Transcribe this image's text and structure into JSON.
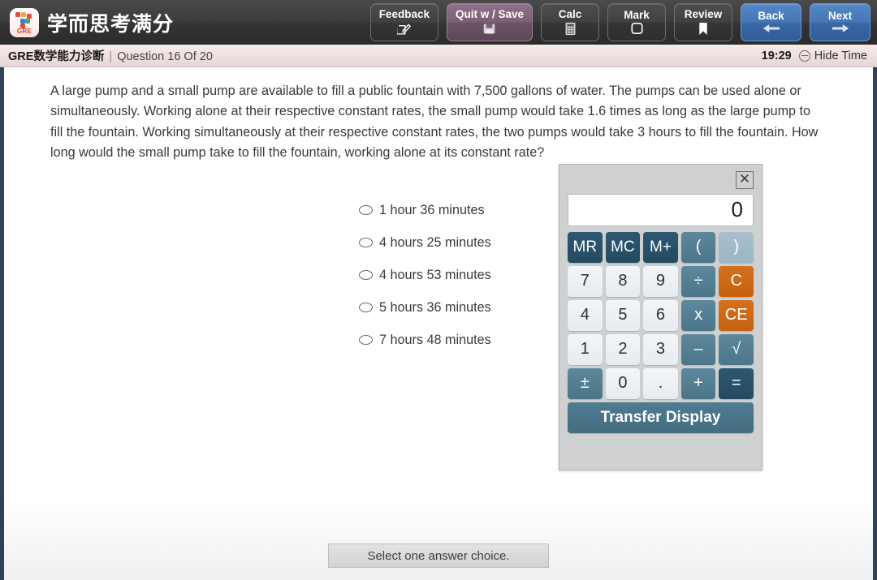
{
  "header": {
    "brand_title": "学而思考满分",
    "logo_badge": "GRE",
    "buttons": [
      {
        "label": "Feedback",
        "icon": "edit-square-icon",
        "style": "default"
      },
      {
        "label": "Quit w / Save",
        "icon": "save-disk-icon",
        "style": "quit"
      },
      {
        "label": "Calc",
        "icon": "calculator-icon",
        "style": "default"
      },
      {
        "label": "Mark",
        "icon": "square-outline-icon",
        "style": "default"
      },
      {
        "label": "Review",
        "icon": "bookmark-icon",
        "style": "default"
      },
      {
        "label": "Back",
        "icon": "arrow-left-icon",
        "style": "nav"
      },
      {
        "label": "Next",
        "icon": "arrow-right-icon",
        "style": "nav"
      }
    ]
  },
  "subheader": {
    "section_name": "GRE数学能力诊断",
    "separator": "|",
    "question_count": "Question 16 Of 20",
    "timer": "19:29",
    "hide_time_label": "Hide Time",
    "hide_time_icon": "minus-circle-icon"
  },
  "question": {
    "stem": "A large pump and a small pump are available to fill a public fountain with 7,500 gallons of water. The pumps can be used alone or simultaneously. Working alone at their respective constant rates, the small pump would take 1.6 times as long as the large pump to fill the fountain. Working simultaneously at their respective constant rates, the two pumps would take 3 hours to fill the fountain. How long would the small pump take to fill the fountain, working alone at its constant rate?",
    "choices": [
      {
        "label": "1 hour 36 minutes",
        "selected": false
      },
      {
        "label": "4 hours 25 minutes",
        "selected": false
      },
      {
        "label": "4 hours 53 minutes",
        "selected": false
      },
      {
        "label": "5 hours 36 minutes",
        "selected": false
      },
      {
        "label": "7 hours 48 minutes",
        "selected": false
      }
    ]
  },
  "calculator": {
    "close_icon": "close-x-icon",
    "display_value": "0",
    "keys": [
      {
        "label": "MR",
        "kind": "mem"
      },
      {
        "label": "MC",
        "kind": "mem"
      },
      {
        "label": "M+",
        "kind": "mem"
      },
      {
        "label": "(",
        "kind": "op"
      },
      {
        "label": ")",
        "kind": "opl"
      },
      {
        "label": "7",
        "kind": "num"
      },
      {
        "label": "8",
        "kind": "num"
      },
      {
        "label": "9",
        "kind": "num"
      },
      {
        "label": "÷",
        "kind": "op"
      },
      {
        "label": "C",
        "kind": "warn"
      },
      {
        "label": "4",
        "kind": "num"
      },
      {
        "label": "5",
        "kind": "num"
      },
      {
        "label": "6",
        "kind": "num"
      },
      {
        "label": "x",
        "kind": "op"
      },
      {
        "label": "CE",
        "kind": "warn"
      },
      {
        "label": "1",
        "kind": "num"
      },
      {
        "label": "2",
        "kind": "num"
      },
      {
        "label": "3",
        "kind": "num"
      },
      {
        "label": "–",
        "kind": "op"
      },
      {
        "label": "√",
        "kind": "op"
      },
      {
        "label": "±",
        "kind": "op"
      },
      {
        "label": "0",
        "kind": "num"
      },
      {
        "label": ".",
        "kind": "num"
      },
      {
        "label": "+",
        "kind": "op"
      },
      {
        "label": "=",
        "kind": "eq"
      }
    ],
    "transfer_label": "Transfer Display"
  },
  "footer": {
    "instruction": "Select one answer choice."
  },
  "colors": {
    "toolbar_bg": "#3d3d3d",
    "subbar_bg": "#eddfe0",
    "nav_button": "#4576b5",
    "quit_button": "#7b5f73",
    "calc_mem": "#244a61",
    "calc_op": "#4c7589",
    "calc_warn": "#c4620f",
    "page_border": "#33405a"
  }
}
